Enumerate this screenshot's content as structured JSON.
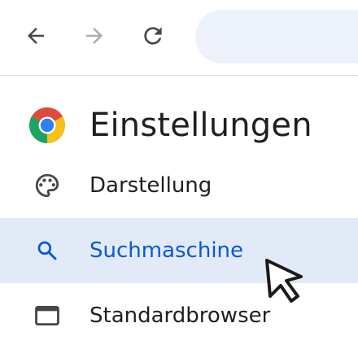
{
  "toolbar": {
    "back_icon": "arrow-left-icon",
    "forward_icon": "arrow-right-icon",
    "reload_icon": "reload-icon",
    "omnibox_value": ""
  },
  "header": {
    "logo_icon": "chrome-logo-icon",
    "title": "Einstellungen"
  },
  "nav": {
    "items": [
      {
        "label": "Darstellung",
        "icon": "palette-icon",
        "selected": false
      },
      {
        "label": "Suchmaschine",
        "icon": "search-icon",
        "selected": true
      },
      {
        "label": "Standardbrowser",
        "icon": "browser-window-icon",
        "selected": false
      }
    ]
  },
  "colors": {
    "accent": "#0b57d0",
    "selected_bg": "#e2eaf8",
    "omnibox_bg": "#edf2fa",
    "text": "#1f1f1f",
    "icon": "#474747",
    "disabled_icon": "#a8abaf"
  },
  "cursor_icon": "mouse-pointer-icon"
}
